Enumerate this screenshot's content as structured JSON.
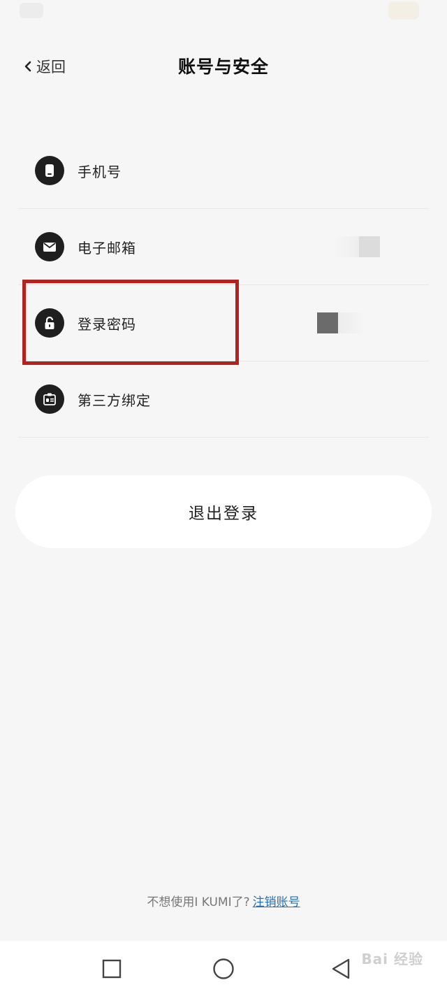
{
  "header": {
    "back_label": "返回",
    "title": "账号与安全"
  },
  "settings": {
    "items": [
      {
        "label": "手机号",
        "icon": "phone-icon"
      },
      {
        "label": "电子邮箱",
        "icon": "mail-icon"
      },
      {
        "label": "登录密码",
        "icon": "lock-icon"
      },
      {
        "label": "第三方绑定",
        "icon": "id-card-icon"
      }
    ]
  },
  "logout": {
    "label": "退出登录"
  },
  "footer": {
    "prompt": "不想使用I KUMI了?",
    "link": "注销账号"
  },
  "watermark": "Bai 经验",
  "colors": {
    "background": "#f6f6f6",
    "icon_bg": "#1f1f1f",
    "highlight": "#b3221f",
    "link": "#2a6fb0"
  }
}
